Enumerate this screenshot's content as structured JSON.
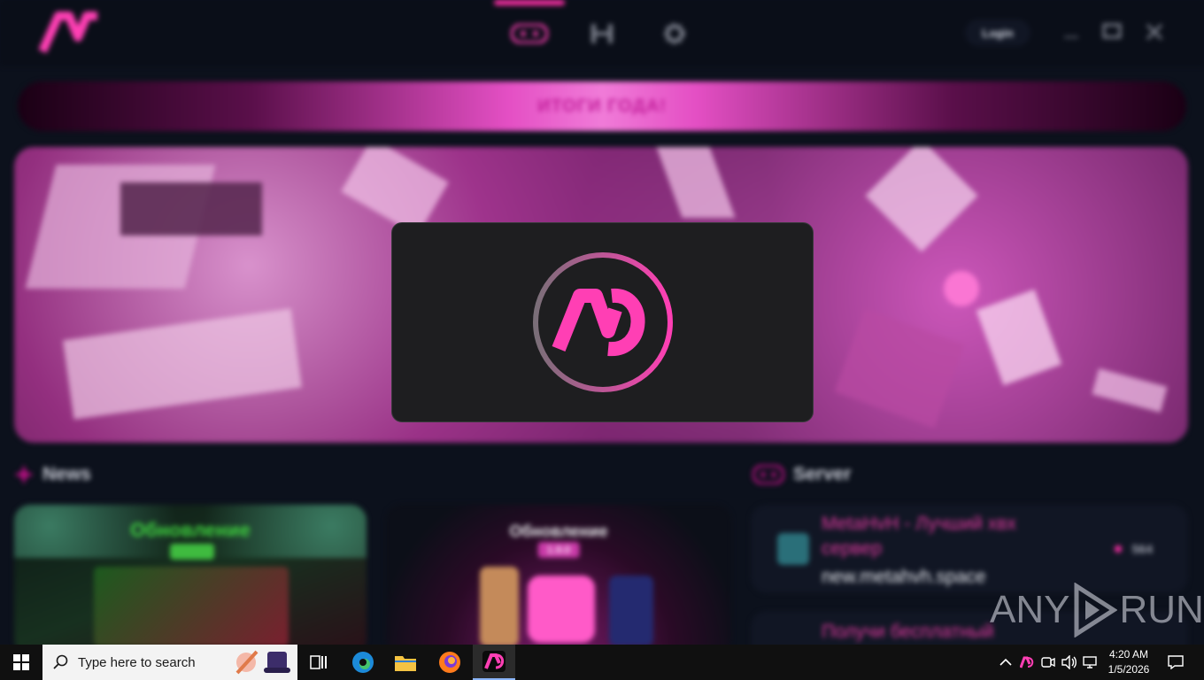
{
  "app": {
    "login_label": "Login",
    "banner_text": "ИТОГИ ГОДА!",
    "sections": {
      "news": "News",
      "server": "Server"
    },
    "news": [
      {
        "title": "Обновление",
        "version": "",
        "title_color": "#3fd33f"
      },
      {
        "title": "Обновление",
        "version": "1.9.0",
        "title_color": "#e7e7ea"
      }
    ],
    "servers": [
      {
        "name": "MetaHvH - Лучший хвх сервер",
        "address": "new.metahvh.space",
        "online": "564"
      },
      {
        "name": "Получи бесплатный",
        "address": "",
        "online": ""
      }
    ],
    "accent_color": "#ff2fa8"
  },
  "watermark": {
    "left": "ANY",
    "right": "RUN"
  },
  "taskbar": {
    "search_placeholder": "Type here to search",
    "time": "4:20 AM",
    "date": "1/5/2026"
  }
}
